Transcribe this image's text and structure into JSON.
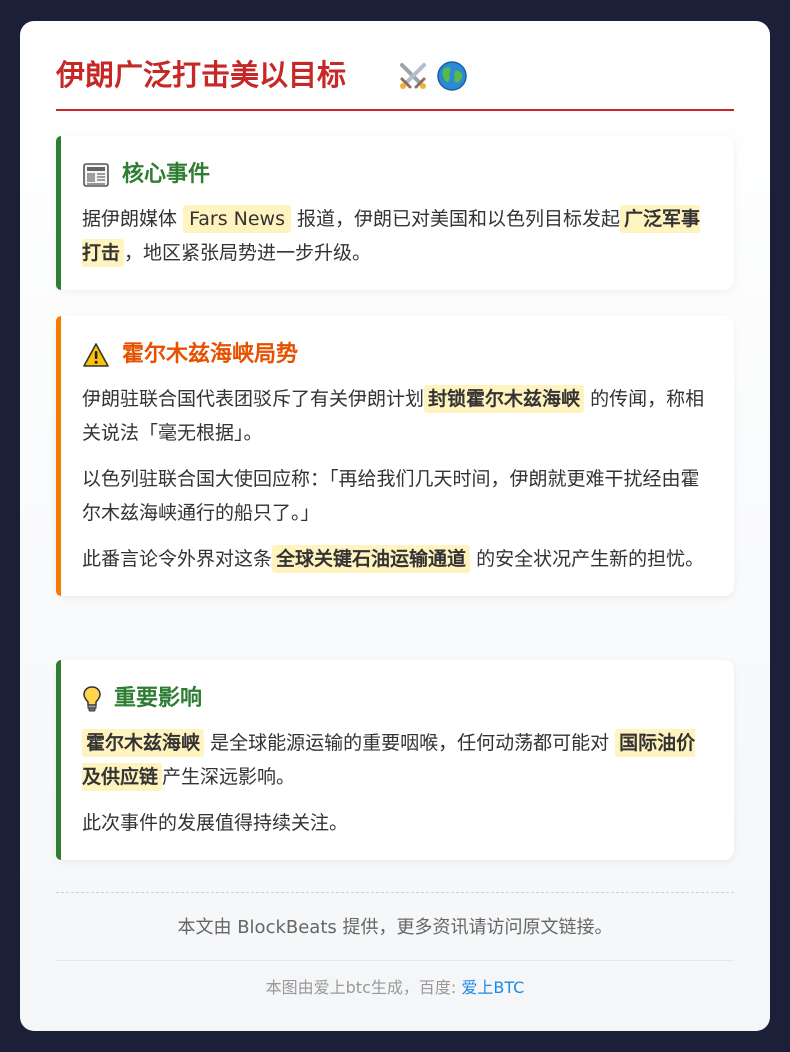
{
  "header": {
    "title": "伊朗广泛打击美以目标",
    "title_icons": [
      "crossed-swords-icon",
      "globe-icon"
    ]
  },
  "sections": [
    {
      "title": "核心事件",
      "icon": "newspaper-icon",
      "accent": "#2e7d32",
      "p1_a": "据伊朗媒体",
      "p1_hl1": "Fars News",
      "p1_b": "报道，伊朗已对美国和以色列目标发起",
      "p1_hl2": "广泛军事打击",
      "p1_c": "，地区紧张局势进一步升级。"
    },
    {
      "title": "霍尔木兹海峡局势",
      "icon": "warning-icon",
      "accent": "#f57c00",
      "p1_a": "伊朗驻联合国代表团驳斥了有关伊朗计划",
      "p1_hl1": "封锁霍尔木兹海峡",
      "p1_b": "的传闻，称相关说法「毫无根据」。",
      "p2": "以色列驻联合国大使回应称：「再给我们几天时间，伊朗就更难干扰经由霍尔木兹海峡通行的船只了。」",
      "p3_a": "此番言论令外界对这条",
      "p3_hl1": "全球关键石油运输通道",
      "p3_b": "的安全状况产生新的担忧。"
    },
    {
      "title": "重要影响",
      "icon": "lightbulb-icon",
      "accent": "#2e7d32",
      "p1_hl1": "霍尔木兹海峡",
      "p1_a": "是全球能源运输的重要咽喉，任何动荡都可能对",
      "p1_hl2": "国际油价及供应链",
      "p1_b": "产生深远影响。",
      "p2": "此次事件的发展值得持续关注。"
    }
  ],
  "footer": {
    "source_text": "本文由 BlockBeats 提供，更多资讯请访问原文链接。",
    "credit_text": "本图由爱上btc生成，百度: ",
    "credit_link": "爱上BTC"
  },
  "colors": {
    "background": "#1b1f38",
    "title_red": "#c62828",
    "green": "#2e7d32",
    "orange": "#f57c00",
    "highlight": "#fff3bf",
    "link": "#1e88e5"
  }
}
